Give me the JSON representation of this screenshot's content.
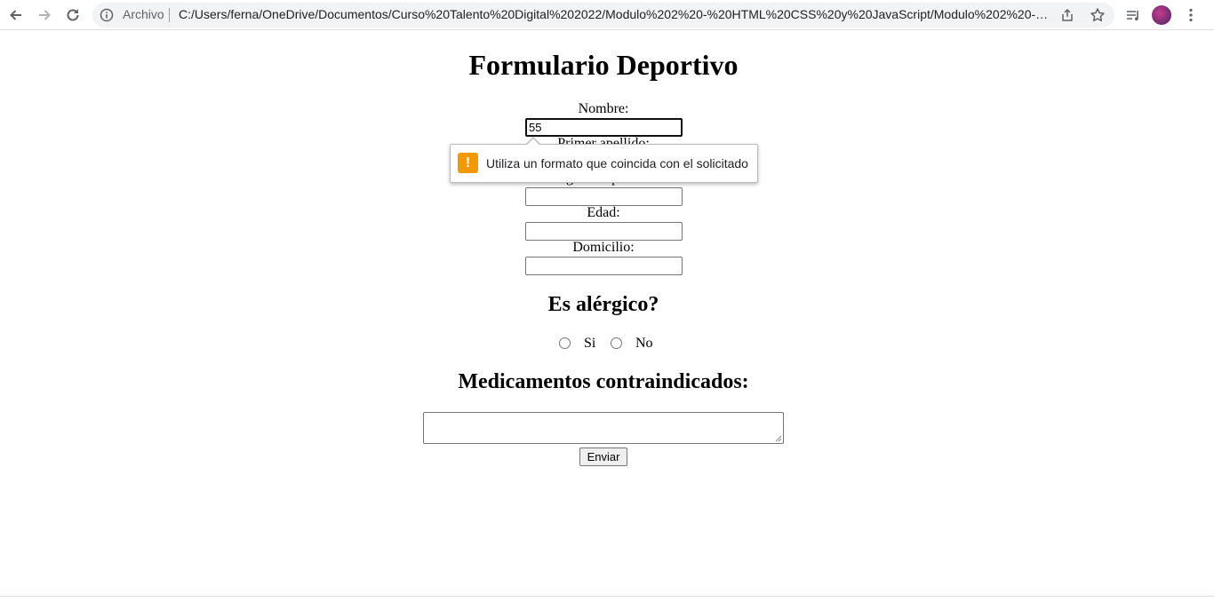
{
  "browser": {
    "address_label": "Archivo",
    "url": "C:/Users/ferna/OneDrive/Documentos/Curso%20Talento%20Digital%202022/Modulo%202%20-%20HTML%20CSS%20y%20JavaScript/Modulo%202%20-%2...",
    "icons": [
      "back-arrow-icon",
      "forward-arrow-icon",
      "reload-icon",
      "info-icon",
      "share-icon",
      "star-icon",
      "reading-list-icon",
      "profile-avatar",
      "menu-kebab-icon"
    ]
  },
  "form": {
    "title": "Formulario Deportivo",
    "fields": [
      {
        "label": "Nombre:",
        "value": "55"
      },
      {
        "label": "Primer apellido:",
        "value": ""
      },
      {
        "label": "Segundo apellido:",
        "value": ""
      },
      {
        "label": "Edad:",
        "value": ""
      },
      {
        "label": "Domicilio:",
        "value": ""
      }
    ],
    "allergy": {
      "heading": "Es alérgico?",
      "options": [
        {
          "label": "Si",
          "checked": false
        },
        {
          "label": "No",
          "checked": false
        }
      ]
    },
    "medications": {
      "heading": "Medicamentos contraindicados:",
      "value": ""
    },
    "submit_label": "Enviar"
  },
  "validation": {
    "message": "Utiliza un formato que coincida con el solicitado",
    "icon": "warning-icon",
    "icon_color": "#f29900"
  }
}
